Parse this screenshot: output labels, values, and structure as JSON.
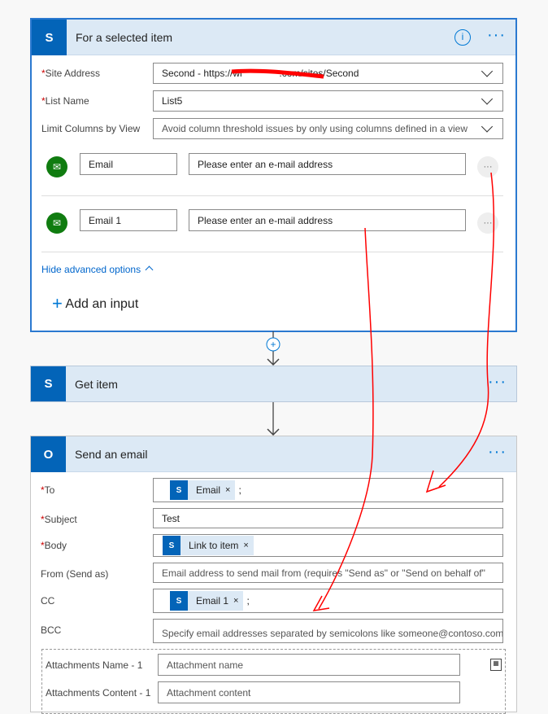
{
  "trigger": {
    "title": "For a selected item",
    "icon": "sharepoint-icon",
    "site_label": "Site Address",
    "site_value": "Second - https://wi                   .com/sites/Second",
    "list_label": "List Name",
    "list_value": "List5",
    "limit_label": "Limit Columns by View",
    "limit_value": "Avoid column threshold issues by only using columns defined in a view",
    "inputs": [
      {
        "name": "Email",
        "placeholder": "Please enter an e-mail address"
      },
      {
        "name": "Email 1",
        "placeholder": "Please enter an e-mail address"
      }
    ],
    "hide_advanced": "Hide advanced options",
    "add_input": "Add an input"
  },
  "get_item": {
    "title": "Get item",
    "icon": "sharepoint-icon"
  },
  "send_email": {
    "title": "Send an email",
    "icon": "outlook-icon",
    "to_label": "To",
    "to_token": "Email",
    "subject_label": "Subject",
    "subject_value": "Test",
    "body_label": "Body",
    "body_token": "Link to item",
    "from_label": "From (Send as)",
    "from_placeholder": "Email address to send mail from (requires \"Send as\" or \"Send on behalf of\"",
    "cc_label": "CC",
    "cc_token": "Email 1",
    "bcc_label": "BCC",
    "bcc_placeholder": "Specify email addresses separated by semicolons like someone@contoso.com",
    "att_name_label": "Attachments Name - 1",
    "att_name_placeholder": "Attachment name",
    "att_content_label": "Attachments Content - 1",
    "att_content_placeholder": "Attachment content"
  },
  "semicolon": ";",
  "x": "×",
  "ellipsis": "···",
  "more": "···",
  "sp": "S",
  "ol": "O",
  "plus": "+"
}
